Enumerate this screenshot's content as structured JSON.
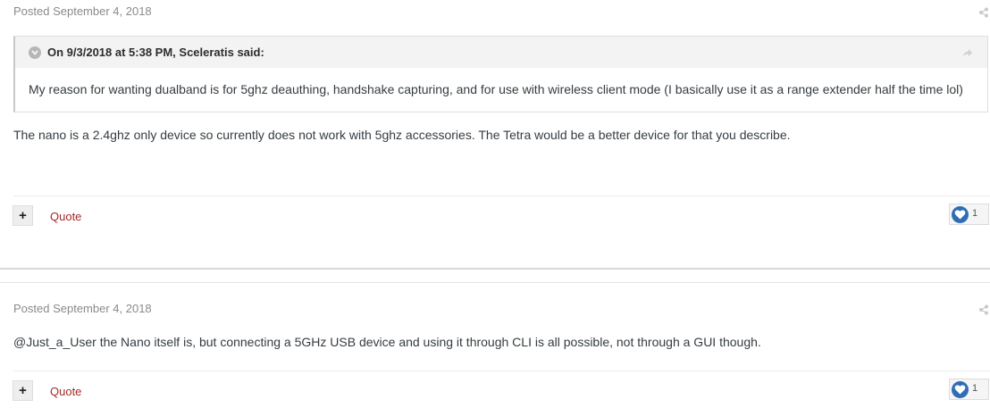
{
  "posts": [
    {
      "meta": "Posted September 4, 2018",
      "quote": {
        "citation": "On 9/3/2018 at 5:38 PM, Sceleratis said:",
        "body": "My reason for wanting dualband is for 5ghz deauthing, handshake capturing, and for use with wireless client mode (I basically use it as a range extender half the time lol)"
      },
      "text": "The nano is a 2.4ghz only device so currently does not work with 5ghz accessories. The Tetra would be a better device for that you describe.",
      "plus_label": "+",
      "quote_label": "Quote",
      "reaction_count": "1"
    },
    {
      "meta": "Posted September 4, 2018",
      "text": "@Just_a_User the Nano itself is, but connecting a 5GHz USB device and using it through CLI is all possible, not through a GUI though.",
      "plus_label": "+",
      "quote_label": "Quote",
      "reaction_count": "1"
    }
  ],
  "icons": {
    "share": "share-icon",
    "quote_share": "reply-arrow-icon",
    "toggle": "chevron-down-icon",
    "reaction": "heart-icon"
  },
  "colors": {
    "quote_link": "#a52a2a",
    "reaction_badge": "#2f6db5",
    "meta_text": "#8a8a8a"
  }
}
